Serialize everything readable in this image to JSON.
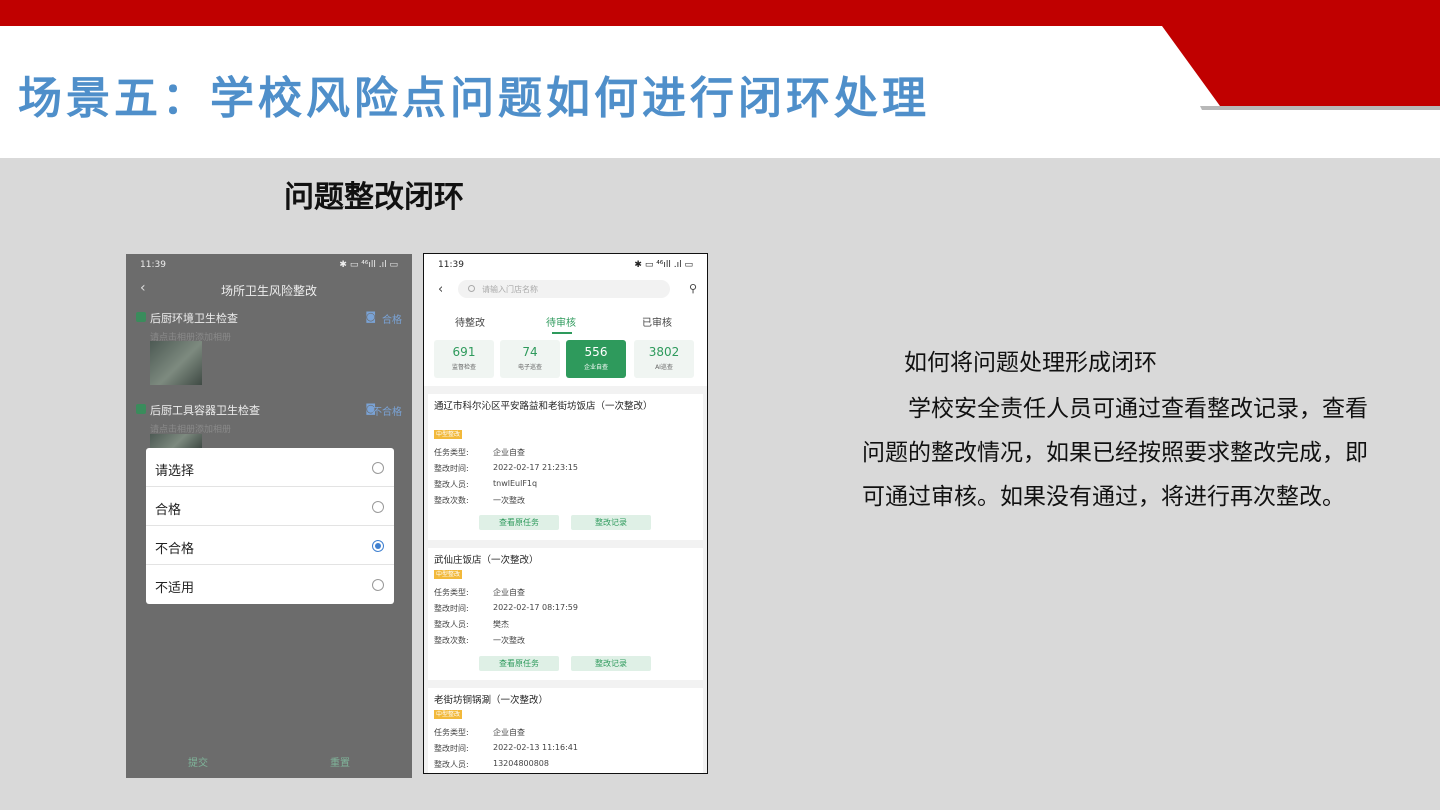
{
  "colors": {
    "accent_red": "#c00000",
    "title_blue": "#4f8fca",
    "app_green": "#2e9a5c",
    "tag_yellow": "#f2b93b"
  },
  "slide": {
    "title": "场景五：学校风险点问题如何进行闭环处理",
    "section_heading": "问题整改闭环"
  },
  "phone1": {
    "status_time": "11:39",
    "status_right": "✱ ▭ ⁴⁶ıll .ıl ▭",
    "back_icon": "chevron-left-icon",
    "title": "场所卫生风险整改",
    "items": [
      {
        "name": "后厨环境卫生检查",
        "hint": "请点击相册添加相册",
        "status": "合格"
      },
      {
        "name": "后厨工具容器卫生检查",
        "hint": "请点击相册添加相册",
        "status": "不合格"
      }
    ],
    "dialog_options": [
      {
        "label": "请选择",
        "selected": false
      },
      {
        "label": "合格",
        "selected": false
      },
      {
        "label": "不合格",
        "selected": true
      },
      {
        "label": "不适用",
        "selected": false
      }
    ],
    "submit_label": "提交",
    "reset_label": "重置"
  },
  "phone2": {
    "status_time": "11:39",
    "status_right": "✱ ▭ ⁴⁶ıll .ıl ▭",
    "search_placeholder": "请输入门店名称",
    "tabs": [
      "待整改",
      "待审核",
      "已审核"
    ],
    "active_tab": "待审核",
    "stats": [
      {
        "num": "691",
        "label": "监督检查"
      },
      {
        "num": "74",
        "label": "电子巡查"
      },
      {
        "num": "556",
        "label": "企业自查"
      },
      {
        "num": "3802",
        "label": "AI巡查"
      }
    ],
    "field_labels": [
      "任务类型:",
      "整改时间:",
      "整改人员:",
      "整改次数:"
    ],
    "view_task_label": "查看原任务",
    "record_label": "整改记录",
    "cards": [
      {
        "title": "通辽市科尔沁区平安路益和老街坊饭店（一次整改）",
        "tag": "中型整改",
        "type": "企业自查",
        "time": "2022-02-17 21:23:15",
        "person": "tnwlEulF1q",
        "count": "一次整改"
      },
      {
        "title": "武仙庄饭店（一次整改）",
        "tag": "中型整改",
        "type": "企业自查",
        "time": "2022-02-17 08:17:59",
        "person": "樊杰",
        "count": "一次整改"
      },
      {
        "title": "老街坊铜锅涮（一次整改）",
        "tag": "中型整改",
        "type": "企业自查",
        "time": "2022-02-13 11:16:41",
        "person": "13204800808",
        "count": ""
      }
    ]
  },
  "explanation": {
    "question": "如何将问题处理形成闭环",
    "body": "学校安全责任人员可通过查看整改记录，查看问题的整改情况，如果已经按照要求整改完成，即可通过审核。如果没有通过，将进行再次整改。"
  }
}
